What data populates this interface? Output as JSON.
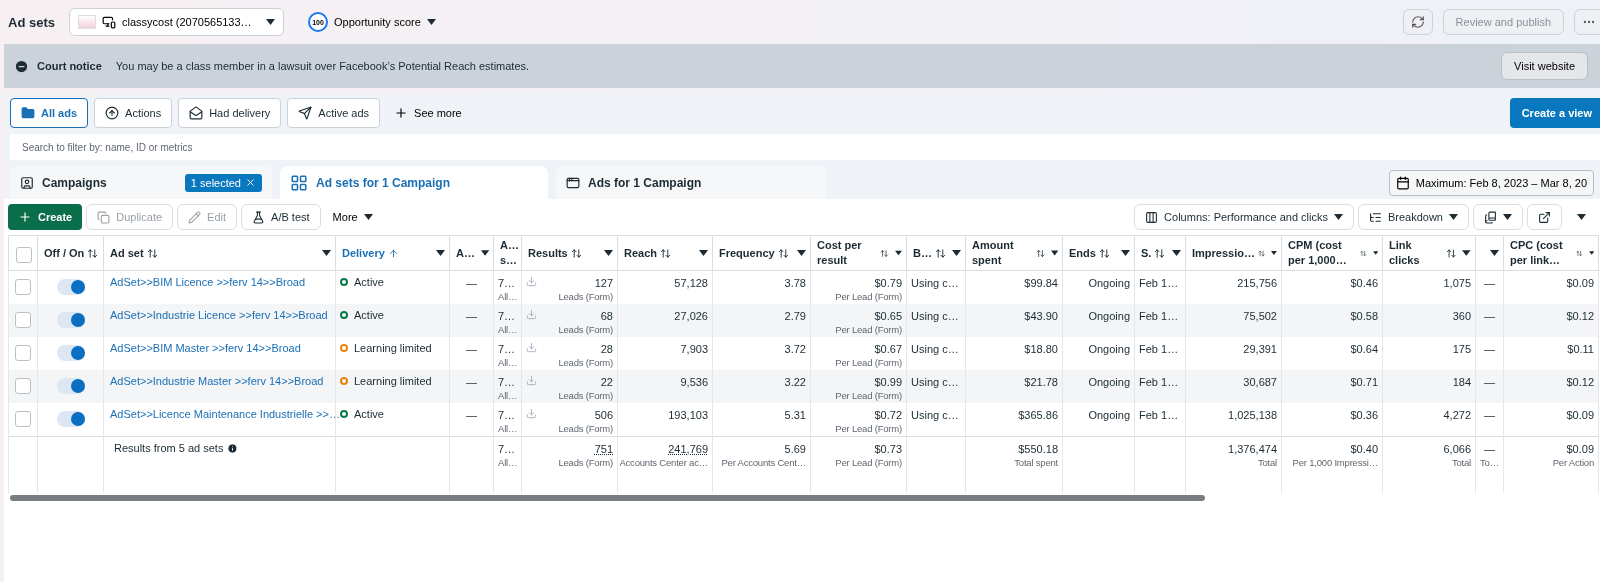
{
  "header": {
    "title": "Ad sets",
    "account": "classycost (2070565133…",
    "score": "100",
    "score_label": "Opportunity score",
    "publish": "Review and publish"
  },
  "notice": {
    "title": "Court notice",
    "text": "You may be a class member in a lawsuit over Facebook’s Potential Reach estimates.",
    "button": "Visit website"
  },
  "filters": [
    {
      "kind": "folder",
      "label": "All ads",
      "selected": true
    },
    {
      "kind": "actions",
      "label": "Actions",
      "selected": false
    },
    {
      "kind": "mail",
      "label": "Had delivery",
      "selected": false
    },
    {
      "kind": "send",
      "label": "Active ads",
      "selected": false
    }
  ],
  "see_more": "See more",
  "create_view": "Create a view",
  "search": {
    "placeholder": "Search to filter by: name, ID or metrics"
  },
  "level_tabs": [
    {
      "kind": "campaigns",
      "label": "Campaigns",
      "badge": "1 selected",
      "selected": false
    },
    {
      "kind": "adsets",
      "label": "Ad sets for 1 Campaign",
      "selected": true
    },
    {
      "kind": "ads",
      "label": "Ads for 1 Campaign",
      "selected": false
    }
  ],
  "date_range": "Maximum: Feb 8, 2023 – Mar 8, 20",
  "toolbar": {
    "create": "Create",
    "duplicate": {
      "label": "Duplicate",
      "disabled": true
    },
    "edit": {
      "label": "Edit",
      "disabled": true
    },
    "ab_test": "A/B test",
    "more": "More",
    "columns": "Columns: Performance and clicks",
    "breakdown": "Breakdown"
  },
  "table": {
    "columns": [
      {
        "kind": "select",
        "checked": false
      },
      {
        "kind": "center",
        "label": "Off / On",
        "sortable": true,
        "sorted": false
      },
      {
        "kind": "text",
        "label": "Ad set",
        "sortable": true,
        "sorted": false
      },
      {
        "kind": "text",
        "label": "Delivery",
        "sortable": true,
        "sorted": true
      },
      {
        "kind": "center",
        "label": "A…"
      },
      {
        "kind": "text",
        "label": "A… s…"
      },
      {
        "kind": "number",
        "label": "Results",
        "sortable": true,
        "sorted": false
      },
      {
        "kind": "number",
        "label": "Reach",
        "sortable": true,
        "sorted": false
      },
      {
        "kind": "number",
        "label": "Frequency",
        "sortable": true,
        "sorted": false
      },
      {
        "kind": "number",
        "label": "Cost per result",
        "sortable": true,
        "sorted": false
      },
      {
        "kind": "text",
        "label": "B…",
        "sortable": true,
        "sorted": false
      },
      {
        "kind": "number",
        "label": "Amount spent",
        "sortable": true,
        "sorted": false
      },
      {
        "kind": "number",
        "label": "Ends",
        "sortable": true,
        "sorted": false
      },
      {
        "kind": "text",
        "label": "S.",
        "sortable": true,
        "sorted": false
      },
      {
        "kind": "number",
        "label": "Impressio…",
        "sortable": true,
        "sorted": false
      },
      {
        "kind": "number",
        "label": "CPM (cost per 1,000…",
        "sortable": true,
        "sorted": false
      },
      {
        "kind": "number",
        "label": "Link clicks",
        "sortable": true,
        "sorted": false
      },
      {
        "kind": "center"
      },
      {
        "kind": "number",
        "label": "CPC (cost per link…",
        "sortable": true,
        "sorted": false
      }
    ],
    "rows": [
      {
        "cells": [
          {
            "kind": "checkbox",
            "checked": false
          },
          {
            "kind": "toggle",
            "on": true
          },
          {
            "kind": "link",
            "value": "AdSet>>BIM Licence >>ferv 14>>Broad"
          },
          {
            "kind": "status",
            "value": "Active",
            "color": "#0a7a4a"
          },
          {
            "value": "—"
          },
          {
            "value": "7…",
            "sub": "All…"
          },
          {
            "value": "127",
            "sub": "Leads (Form)",
            "kind": "download"
          },
          {
            "value": "57,128"
          },
          {
            "value": "3.78"
          },
          {
            "value": "$0.79",
            "sub": "Per Lead (Form)"
          },
          {
            "value": "Using c…"
          },
          {
            "value": "$99.84"
          },
          {
            "value": "Ongoing"
          },
          {
            "value": "Feb 1…"
          },
          {
            "value": "215,756"
          },
          {
            "value": "$0.46"
          },
          {
            "value": "1,075"
          },
          {
            "value": "—"
          },
          {
            "value": "$0.09"
          }
        ]
      },
      {
        "cells": [
          {
            "kind": "checkbox",
            "checked": false
          },
          {
            "kind": "toggle",
            "on": true
          },
          {
            "kind": "link",
            "value": "AdSet>>Industrie Licence >>ferv 14>>Broad"
          },
          {
            "kind": "status",
            "value": "Active",
            "color": "#0a7a4a"
          },
          {
            "value": "—"
          },
          {
            "value": "7…",
            "sub": "All…"
          },
          {
            "value": "68",
            "sub": "Leads (Form)",
            "kind": "download"
          },
          {
            "value": "27,026"
          },
          {
            "value": "2.79"
          },
          {
            "value": "$0.65",
            "sub": "Per Lead (Form)"
          },
          {
            "value": "Using c…"
          },
          {
            "value": "$43.90"
          },
          {
            "value": "Ongoing"
          },
          {
            "value": "Feb 1…"
          },
          {
            "value": "75,502"
          },
          {
            "value": "$0.58"
          },
          {
            "value": "360"
          },
          {
            "value": "—"
          },
          {
            "value": "$0.12"
          }
        ]
      },
      {
        "cells": [
          {
            "kind": "checkbox",
            "checked": false
          },
          {
            "kind": "toggle",
            "on": true
          },
          {
            "kind": "link",
            "value": "AdSet>>BIM Master >>ferv 14>>Broad"
          },
          {
            "kind": "status",
            "value": "Learning limited",
            "color": "#e8850c"
          },
          {
            "value": "—"
          },
          {
            "value": "7…",
            "sub": "All…"
          },
          {
            "value": "28",
            "sub": "Leads (Form)",
            "kind": "download"
          },
          {
            "value": "7,903"
          },
          {
            "value": "3.72"
          },
          {
            "value": "$0.67",
            "sub": "Per Lead (Form)"
          },
          {
            "value": "Using c…"
          },
          {
            "value": "$18.80"
          },
          {
            "value": "Ongoing"
          },
          {
            "value": "Feb 1…"
          },
          {
            "value": "29,391"
          },
          {
            "value": "$0.64"
          },
          {
            "value": "175"
          },
          {
            "value": "—"
          },
          {
            "value": "$0.11"
          }
        ]
      },
      {
        "cells": [
          {
            "kind": "checkbox",
            "checked": false
          },
          {
            "kind": "toggle",
            "on": true
          },
          {
            "kind": "link",
            "value": "AdSet>>Industrie Master >>ferv 14>>Broad"
          },
          {
            "kind": "status",
            "value": "Learning limited",
            "color": "#e8850c"
          },
          {
            "value": "—"
          },
          {
            "value": "7…",
            "sub": "All…"
          },
          {
            "value": "22",
            "sub": "Leads (Form)",
            "kind": "download"
          },
          {
            "value": "9,536"
          },
          {
            "value": "3.22"
          },
          {
            "value": "$0.99",
            "sub": "Per Lead (Form)"
          },
          {
            "value": "Using c…"
          },
          {
            "value": "$21.78"
          },
          {
            "value": "Ongoing"
          },
          {
            "value": "Feb 1…"
          },
          {
            "value": "30,687"
          },
          {
            "value": "$0.71"
          },
          {
            "value": "184"
          },
          {
            "value": "—"
          },
          {
            "value": "$0.12"
          }
        ]
      },
      {
        "cells": [
          {
            "kind": "checkbox",
            "checked": false
          },
          {
            "kind": "toggle",
            "on": true
          },
          {
            "kind": "link",
            "value": "AdSet>>Licence Maintenance Industrielle >>…"
          },
          {
            "kind": "status",
            "value": "Active",
            "color": "#0a7a4a"
          },
          {
            "value": "—"
          },
          {
            "value": "7…",
            "sub": "All…"
          },
          {
            "value": "506",
            "sub": "Leads (Form)",
            "kind": "download"
          },
          {
            "value": "193,103"
          },
          {
            "value": "5.31"
          },
          {
            "value": "$0.72",
            "sub": "Per Lead (Form)"
          },
          {
            "value": "Using c…"
          },
          {
            "value": "$365.86"
          },
          {
            "value": "Ongoing"
          },
          {
            "value": "Feb 1…"
          },
          {
            "value": "1,025,138"
          },
          {
            "value": "$0.36"
          },
          {
            "value": "4,272"
          },
          {
            "value": "—"
          },
          {
            "value": "$0.09"
          }
        ]
      }
    ],
    "totals": {
      "cells": [
        {},
        {},
        {
          "kind": "info",
          "value": "Results from 5 ad sets"
        },
        {},
        {},
        {
          "value": "7…",
          "sub": "All…"
        },
        {
          "value": "751",
          "sub": "Leads (Form)",
          "dotted": true
        },
        {
          "value": "241,769",
          "sub": "Accounts Center ac…",
          "dotted": true
        },
        {
          "value": "5.69",
          "sub": "Per Accounts Cent…"
        },
        {
          "value": "$0.73",
          "sub": "Per Lead (Form)"
        },
        {},
        {
          "value": "$550.18",
          "sub": "Total spent"
        },
        {},
        {},
        {
          "value": "1,376,474",
          "sub": "Total"
        },
        {
          "value": "$0.40",
          "sub": "Per 1,000 Impressi…"
        },
        {
          "value": "6,066",
          "sub": "Total"
        },
        {
          "value": "—",
          "sub": "To…"
        },
        {
          "value": "$0.09",
          "sub": "Per Action"
        }
      ]
    }
  }
}
